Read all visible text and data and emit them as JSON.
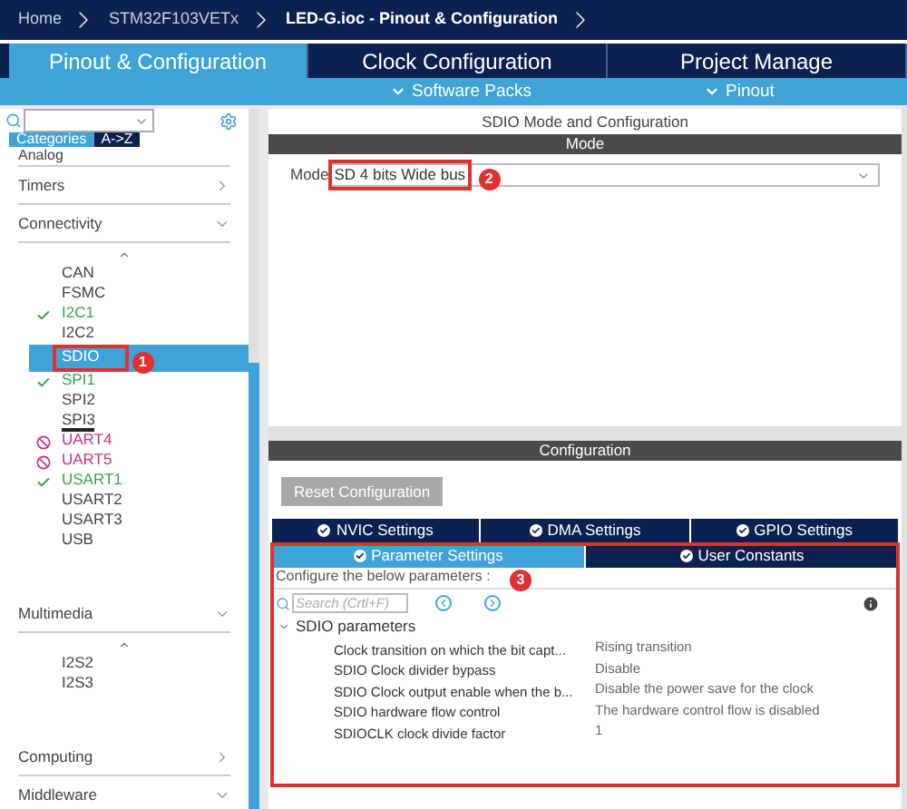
{
  "breadcrumbs": [
    {
      "label": "Home",
      "current": false
    },
    {
      "label": "STM32F103VETx",
      "current": false
    },
    {
      "label": "LED-G.ioc - Pinout & Configuration",
      "current": true
    }
  ],
  "main_tabs": [
    {
      "label": "Pinout & Configuration",
      "selected": true
    },
    {
      "label": "Clock Configuration",
      "selected": false
    },
    {
      "label": "Project Manage",
      "selected": false
    }
  ],
  "sub_menus": [
    "Software Packs",
    "Pinout"
  ],
  "sidebar": {
    "view_tabs": [
      {
        "label": "Categories",
        "selected": true
      },
      {
        "label": "A->Z",
        "selected": false
      }
    ],
    "top_item": "Analog",
    "categories": [
      {
        "label": "Timers",
        "expanded": false
      },
      {
        "label": "Connectivity",
        "expanded": true,
        "children": [
          {
            "label": "CAN",
            "enabled": false,
            "conflict": false,
            "selected": false,
            "underlined": false
          },
          {
            "label": "FSMC",
            "enabled": false,
            "conflict": false,
            "selected": false,
            "underlined": false
          },
          {
            "label": "I2C1",
            "enabled": true,
            "conflict": false,
            "selected": false,
            "underlined": false
          },
          {
            "label": "I2C2",
            "enabled": false,
            "conflict": false,
            "selected": false,
            "underlined": false
          },
          {
            "label": "SDIO",
            "enabled": false,
            "conflict": false,
            "selected": true,
            "underlined": false,
            "annotation": "1"
          },
          {
            "label": "SPI1",
            "enabled": true,
            "conflict": false,
            "selected": false,
            "underlined": false
          },
          {
            "label": "SPI2",
            "enabled": false,
            "conflict": false,
            "selected": false,
            "underlined": false
          },
          {
            "label": "SPI3",
            "enabled": false,
            "conflict": false,
            "selected": false,
            "underlined": true
          },
          {
            "label": "UART4",
            "enabled": false,
            "conflict": true,
            "selected": false,
            "underlined": false
          },
          {
            "label": "UART5",
            "enabled": false,
            "conflict": true,
            "selected": false,
            "underlined": false
          },
          {
            "label": "USART1",
            "enabled": true,
            "conflict": false,
            "selected": false,
            "underlined": false
          },
          {
            "label": "USART2",
            "enabled": false,
            "conflict": false,
            "selected": false,
            "underlined": false
          },
          {
            "label": "USART3",
            "enabled": false,
            "conflict": false,
            "selected": false,
            "underlined": false
          },
          {
            "label": "USB",
            "enabled": false,
            "conflict": false,
            "selected": false,
            "underlined": false
          }
        ]
      },
      {
        "label": "Multimedia",
        "expanded": true,
        "children": [
          {
            "label": "I2S2",
            "enabled": false,
            "conflict": false,
            "selected": false,
            "underlined": false
          },
          {
            "label": "I2S3",
            "enabled": false,
            "conflict": false,
            "selected": false,
            "underlined": false
          }
        ]
      },
      {
        "label": "Computing",
        "expanded": false
      },
      {
        "label": "Middleware",
        "expanded": true
      }
    ]
  },
  "panel_title": "SDIO Mode and Configuration",
  "mode_section": {
    "header": "Mode",
    "label": "Mode",
    "value": "SD 4 bits Wide bus",
    "annotation": "2"
  },
  "configuration": {
    "header": "Configuration",
    "reset_button": "Reset Configuration",
    "tabs": [
      {
        "label": "NVIC Settings",
        "selected": false
      },
      {
        "label": "DMA Settings",
        "selected": false
      },
      {
        "label": "GPIO Settings",
        "selected": false
      },
      {
        "label": "Parameter Settings",
        "selected": true
      },
      {
        "label": "User Constants",
        "selected": false
      }
    ],
    "annotation": "3",
    "hint": "Configure the below parameters :",
    "search": {
      "placeholder": "Search (Crtl+F)"
    },
    "group": {
      "label": "SDIO parameters",
      "expanded": true,
      "rows": [
        {
          "name": "Clock transition on which the bit capt...",
          "value": "Rising transition"
        },
        {
          "name": "SDIO Clock divider bypass",
          "value": "Disable"
        },
        {
          "name": "SDIO Clock output enable when the b...",
          "value": "Disable the power save for the clock"
        },
        {
          "name": "SDIO hardware flow control",
          "value": "The hardware control flow is disabled"
        },
        {
          "name": "SDIOCLK clock divide factor",
          "value": "1"
        }
      ]
    }
  }
}
